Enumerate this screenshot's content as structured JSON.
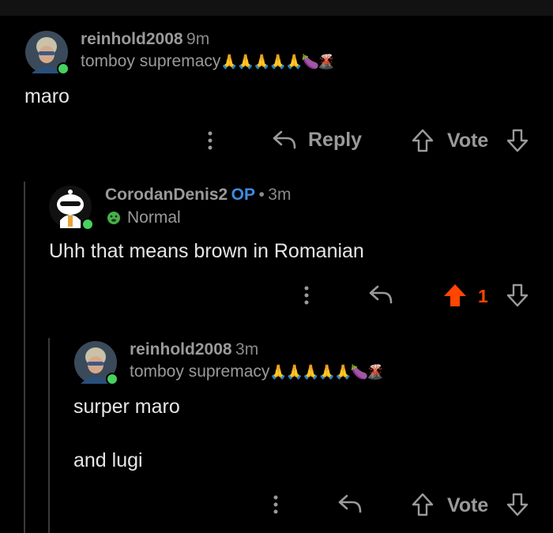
{
  "comments": [
    {
      "username": "reinhold2008",
      "time": "9m",
      "flair_text": "tomboy supremacy",
      "flair_emoji": "🙏🙏🙏🙏🙏🍆🌋",
      "body": [
        "maro"
      ],
      "actions": {
        "reply_label": "Reply",
        "vote_label": "Vote"
      }
    },
    {
      "username": "CorodanDenis2",
      "op_label": "OP",
      "separator": "•",
      "time": "3m",
      "flair_text": "Normal",
      "body": [
        "Uhh that means brown in Romanian"
      ],
      "actions": {
        "vote_count": "1"
      }
    },
    {
      "username": "reinhold2008",
      "time": "3m",
      "flair_text": "tomboy supremacy",
      "flair_emoji": "🙏🙏🙏🙏🙏🍆🌋",
      "body": [
        "surper maro",
        "and lugi"
      ],
      "actions": {
        "vote_label": "Vote"
      }
    }
  ],
  "colors": {
    "background": "#000000",
    "upvote_active": "#ff4500",
    "op": "#3d8ce0",
    "online": "#46d160"
  }
}
